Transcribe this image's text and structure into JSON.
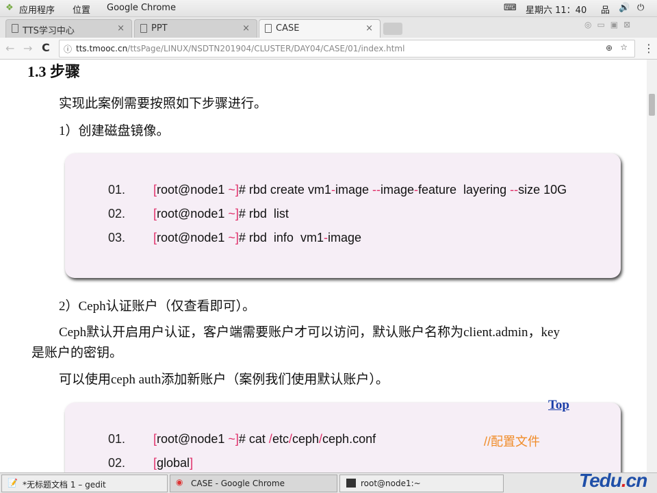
{
  "system_bar": {
    "apps": "应用程序",
    "places": "位置",
    "active_app": "Google Chrome",
    "clock": "星期六 11：40"
  },
  "tabs": [
    {
      "label": "TTS学习中心"
    },
    {
      "label": "PPT"
    },
    {
      "label": "CASE",
      "active": true
    }
  ],
  "address": {
    "host": "tts.tmooc.cn",
    "path": "/ttsPage/LINUX/NSDTN201904/CLUSTER/DAY04/CASE/01/index.html"
  },
  "page": {
    "heading": "1.3 步骤",
    "intro": "实现此案例需要按照如下步骤进行。",
    "step1": "1）创建磁盘镜像。",
    "code1": [
      {
        "num": "01.",
        "segs": [
          [
            "[",
            "red"
          ],
          [
            "root@node1 ",
            ""
          ],
          [
            "~",
            "red"
          ],
          [
            "]",
            "red"
          ],
          [
            "# rbd create vm1",
            ""
          ],
          [
            "-",
            "red"
          ],
          [
            "image ",
            ""
          ],
          [
            "--",
            "red"
          ],
          [
            "image",
            ""
          ],
          [
            "-",
            "red"
          ],
          [
            "feature  layering ",
            ""
          ],
          [
            "--",
            "red"
          ],
          [
            "size 10G",
            ""
          ]
        ]
      },
      {
        "num": "02.",
        "segs": [
          [
            "[",
            "red"
          ],
          [
            "root@node1 ",
            ""
          ],
          [
            "~",
            "red"
          ],
          [
            "]",
            "red"
          ],
          [
            "# rbd  list",
            ""
          ]
        ]
      },
      {
        "num": "03.",
        "segs": [
          [
            "[",
            "red"
          ],
          [
            "root@node1 ",
            ""
          ],
          [
            "~",
            "red"
          ],
          [
            "]",
            "red"
          ],
          [
            "# rbd  info  vm1",
            ""
          ],
          [
            "-",
            "red"
          ],
          [
            "image",
            ""
          ]
        ]
      }
    ],
    "step2": "2）Ceph认证账户（仅查看即可）。",
    "para1": "Ceph默认开启用户认证，客户端需要账户才可以访问，默认账户名称为client.admin，key",
    "para1b": "是账户的密钥。",
    "para2": "可以使用ceph auth添加新账户（案例我们使用默认账户）。",
    "top_link": "Top",
    "code2": [
      {
        "num": "01.",
        "segs": [
          [
            "[",
            "red"
          ],
          [
            "root@node1 ",
            ""
          ],
          [
            "~",
            "red"
          ],
          [
            "]",
            "red"
          ],
          [
            "# cat ",
            ""
          ],
          [
            "/",
            "red"
          ],
          [
            "etc",
            ""
          ],
          [
            "/",
            "red"
          ],
          [
            "ceph",
            ""
          ],
          [
            "/",
            "red"
          ],
          [
            "ceph.conf",
            ""
          ]
        ],
        "comment": "//配置文件"
      },
      {
        "num": "02.",
        "segs": [
          [
            "[",
            "red"
          ],
          [
            "global",
            ""
          ],
          [
            "]",
            "red"
          ]
        ]
      }
    ]
  },
  "taskbar": [
    {
      "label": "*无标题文档 1 – gedit"
    },
    {
      "label": "CASE - Google Chrome"
    },
    {
      "label": "root@node1:~"
    }
  ],
  "logo": "Tedu.cn"
}
